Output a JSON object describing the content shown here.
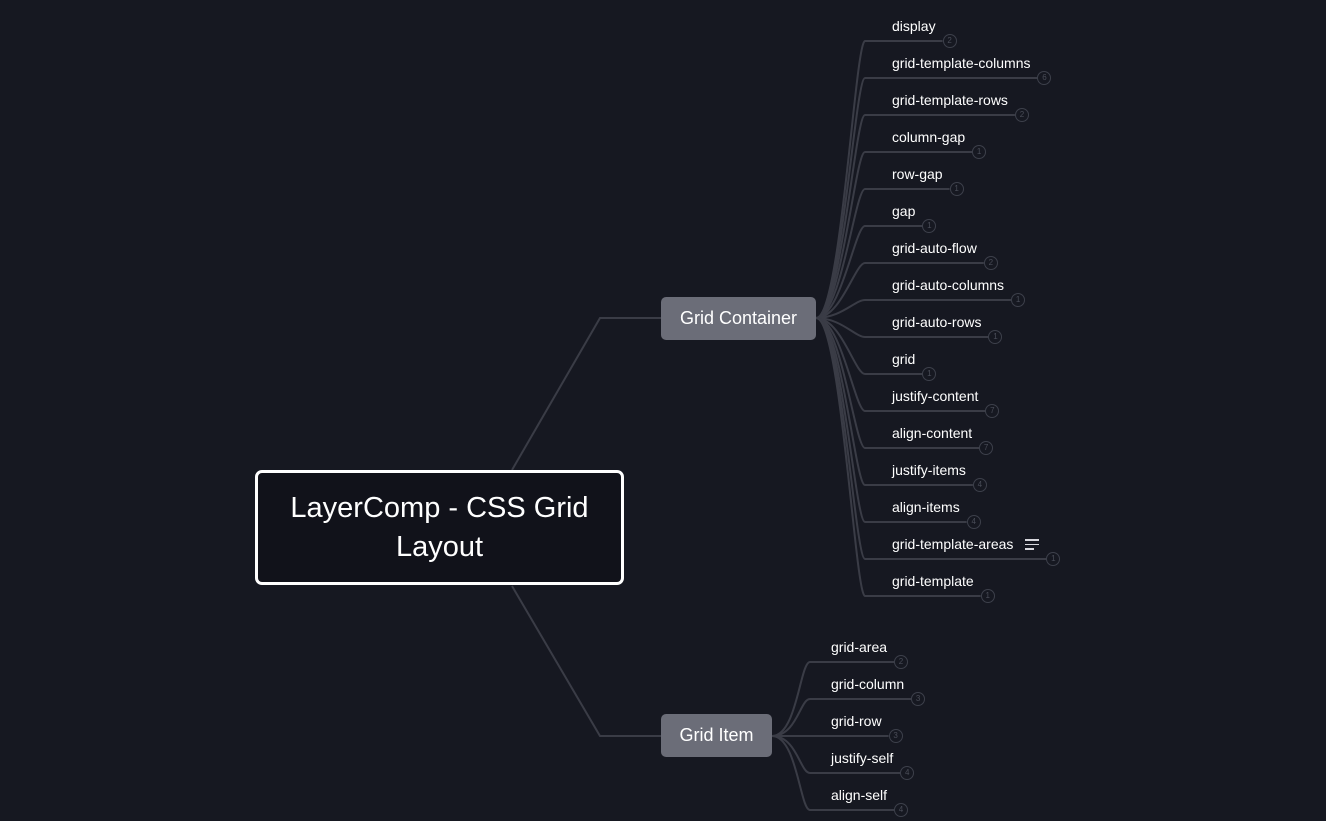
{
  "root": {
    "title": "LayerComp - CSS Grid Layout"
  },
  "branches": [
    {
      "label": "Grid Container",
      "children": [
        {
          "label": "display",
          "count": "2"
        },
        {
          "label": "grid-template-columns",
          "count": "6"
        },
        {
          "label": "grid-template-rows",
          "count": "2"
        },
        {
          "label": "column-gap",
          "count": "1"
        },
        {
          "label": "row-gap",
          "count": "1"
        },
        {
          "label": "gap",
          "count": "1"
        },
        {
          "label": "grid-auto-flow",
          "count": "2"
        },
        {
          "label": "grid-auto-columns",
          "count": "1"
        },
        {
          "label": "grid-auto-rows",
          "count": "1"
        },
        {
          "label": "grid",
          "count": "1"
        },
        {
          "label": "justify-content",
          "count": "7"
        },
        {
          "label": "align-content",
          "count": "7"
        },
        {
          "label": "justify-items",
          "count": "4"
        },
        {
          "label": "align-items",
          "count": "4"
        },
        {
          "label": "grid-template-areas",
          "count": "1",
          "note_icon": "notes-icon"
        },
        {
          "label": "grid-template",
          "count": "1"
        }
      ]
    },
    {
      "label": "Grid Item",
      "children": [
        {
          "label": "grid-area",
          "count": "2"
        },
        {
          "label": "grid-column",
          "count": "3"
        },
        {
          "label": "grid-row",
          "count": "3"
        },
        {
          "label": "justify-self",
          "count": "4"
        },
        {
          "label": "align-self",
          "count": "4"
        }
      ]
    }
  ],
  "colors": {
    "background": "#161821",
    "connector": "#3a3c46",
    "branch_fill": "#6b6d78",
    "root_border": "#ffffff",
    "text": "#ffffff"
  }
}
